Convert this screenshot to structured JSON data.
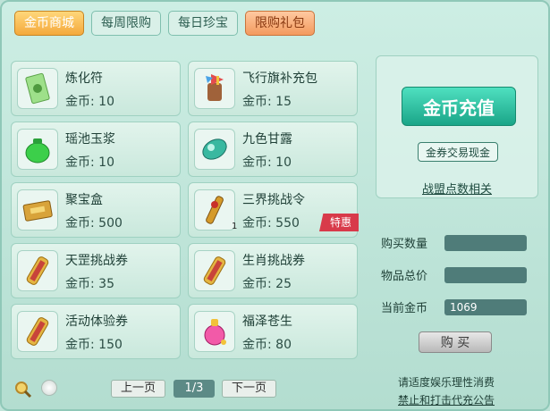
{
  "tabs": [
    {
      "label": "金币商城"
    },
    {
      "label": "每周限购"
    },
    {
      "label": "每日珍宝"
    },
    {
      "label": "限购礼包"
    }
  ],
  "items": [
    {
      "name": "炼化符",
      "price": "金币: 10",
      "icon": "talisman-icon"
    },
    {
      "name": "飞行旗补充包",
      "price": "金币: 15",
      "icon": "flag-pack-icon"
    },
    {
      "name": "瑶池玉浆",
      "price": "金币: 10",
      "icon": "jade-jar-icon"
    },
    {
      "name": "九色甘露",
      "price": "金币: 10",
      "icon": "dew-gem-icon"
    },
    {
      "name": "聚宝盒",
      "price": "金币: 500",
      "icon": "treasure-box-icon"
    },
    {
      "name": "三界挑战令",
      "price": "金币: 550",
      "icon": "challenge-token-icon",
      "count": "1",
      "badge": "特惠"
    },
    {
      "name": "天罡挑战券",
      "price": "金币: 35",
      "icon": "scroll-icon"
    },
    {
      "name": "生肖挑战券",
      "price": "金币: 25",
      "icon": "scroll-icon"
    },
    {
      "name": "活动体验券",
      "price": "金币: 150",
      "icon": "scroll-icon"
    },
    {
      "name": "福泽苍生",
      "price": "金币: 80",
      "icon": "potion-icon"
    }
  ],
  "right": {
    "recharge": "金币充值",
    "coupon": "金券交易现金",
    "alliance": "战盟点数相关",
    "qty_label": "购买数量",
    "total_label": "物品总价",
    "coins_label": "当前金币",
    "coins_value": "1069",
    "buy": "购 买"
  },
  "pager": {
    "prev": "上一页",
    "page": "1/3",
    "next": "下一页"
  },
  "footer": {
    "line1": "请适度娱乐理性消费",
    "line2": "禁止和打击代充公告"
  }
}
